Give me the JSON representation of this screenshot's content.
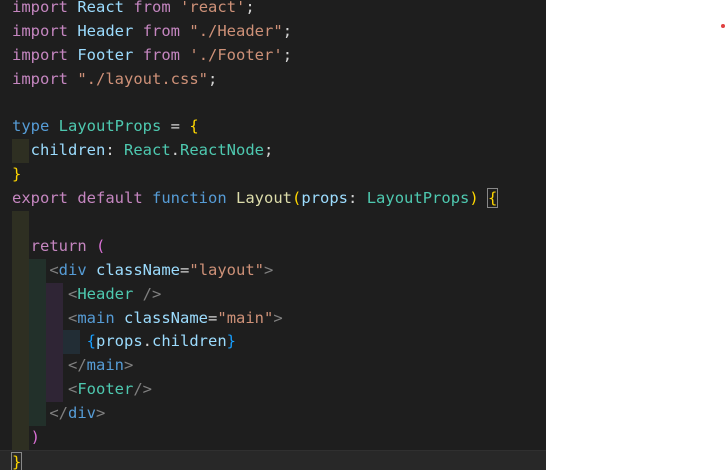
{
  "editor": {
    "tokens": {
      "import": "import",
      "from": "from",
      "type": "type",
      "export": "export",
      "default": "default",
      "function": "function",
      "return": "return"
    },
    "l1": {
      "name": "React",
      "src": "'react'",
      "semi": ";"
    },
    "l2": {
      "name": "Header",
      "src": "\"./Header\"",
      "semi": ";"
    },
    "l3": {
      "name": "Footer",
      "src": "'./Footer'",
      "semi": ";"
    },
    "l4": {
      "src": "\"./layout.css\"",
      "semi": ";"
    },
    "l6": {
      "name": "LayoutProps",
      "eq": " = ",
      "open": "{"
    },
    "l7": {
      "prop": "children",
      "colon": ": ",
      "ns": "React",
      "dot": ".",
      "type": "ReactNode",
      "semi": ";"
    },
    "l8": {
      "close": "}"
    },
    "l9": {
      "fname": "Layout",
      "popen": "(",
      "param": "props",
      "colon": ": ",
      "ptype": "LayoutProps",
      "pclose": ")",
      "space": " ",
      "bopen": "{"
    },
    "l11": {
      "paren": "("
    },
    "l12": {
      "lt": "<",
      "tag": "div",
      "attr": "className",
      "eq": "=",
      "val": "\"layout\"",
      "gt": ">"
    },
    "l13": {
      "lt": "<",
      "tag": "Header",
      "close": " />"
    },
    "l14": {
      "lt": "<",
      "tag": "main",
      "attr": "className",
      "eq": "=",
      "val": "\"main\"",
      "gt": ">"
    },
    "l15": {
      "open": "{",
      "obj": "props",
      "dot": ".",
      "prop": "children",
      "close": "}"
    },
    "l16": {
      "lt": "</",
      "tag": "main",
      "gt": ">"
    },
    "l17": {
      "lt": "<",
      "tag": "Footer",
      "close": "/>"
    },
    "l18": {
      "lt": "</",
      "tag": "div",
      "gt": ">"
    },
    "l19": {
      "paren": ")"
    },
    "l20": {
      "bclose": "}"
    }
  },
  "colors": {
    "editor_background": "#1e1e1e",
    "keyword": "#c586c0",
    "storage": "#569cd6",
    "function": "#dcdcaa",
    "type": "#4ec9b0",
    "string": "#ce9178",
    "variable": "#9cdcfe",
    "bracket_level_1": "#ffd700",
    "bracket_level_2": "#da70d6",
    "bracket_level_3": "#179fff"
  }
}
